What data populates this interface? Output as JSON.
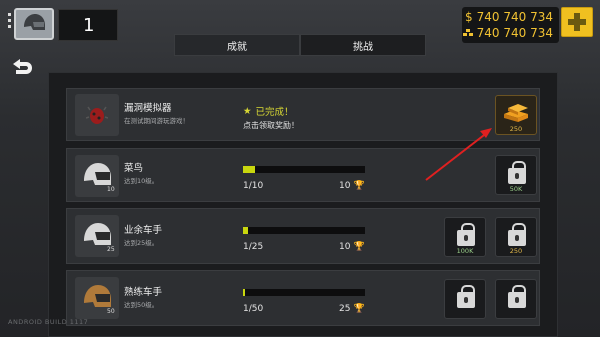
{
  "header": {
    "level": "1",
    "currency_cash": "740 740 734",
    "currency_gold": "740 740 734"
  },
  "tabs": [
    {
      "label": "成就"
    },
    {
      "label": "挑战"
    }
  ],
  "achievements": [
    {
      "name": "漏洞模拟器",
      "desc": "在测试期间游玩游戏！",
      "status": "已完成！",
      "sub": "点击领取奖励！",
      "rewards": [
        {
          "label": "250",
          "type": "gold"
        }
      ]
    },
    {
      "name": "菜鸟",
      "desc": "达到10级。",
      "level_badge": "10",
      "progress_text": "1/10",
      "progress_fraction": 0.1,
      "points": "10",
      "rewards": [
        {
          "label": "50K",
          "type": "cash",
          "locked": true
        }
      ]
    },
    {
      "name": "业余车手",
      "desc": "达到25级。",
      "level_badge": "25",
      "progress_text": "1/25",
      "progress_fraction": 0.04,
      "points": "10",
      "rewards": [
        {
          "label": "100K",
          "type": "cash",
          "locked": true
        },
        {
          "label": "250",
          "type": "gold",
          "locked": true
        }
      ]
    },
    {
      "name": "熟练车手",
      "desc": "达到50级。",
      "level_badge": "50",
      "progress_text": "1/50",
      "progress_fraction": 0.02,
      "points": "25",
      "rewards": [
        {
          "label": "",
          "type": "cash",
          "locked": true
        },
        {
          "label": "",
          "type": "gold",
          "locked": true
        }
      ]
    }
  ],
  "watermark": "ANDROID BUILD 1117",
  "colors": {
    "accent_yellow": "#f0c020",
    "progress_fill": "#c9d70e",
    "annotation_arrow": "#e02020"
  }
}
